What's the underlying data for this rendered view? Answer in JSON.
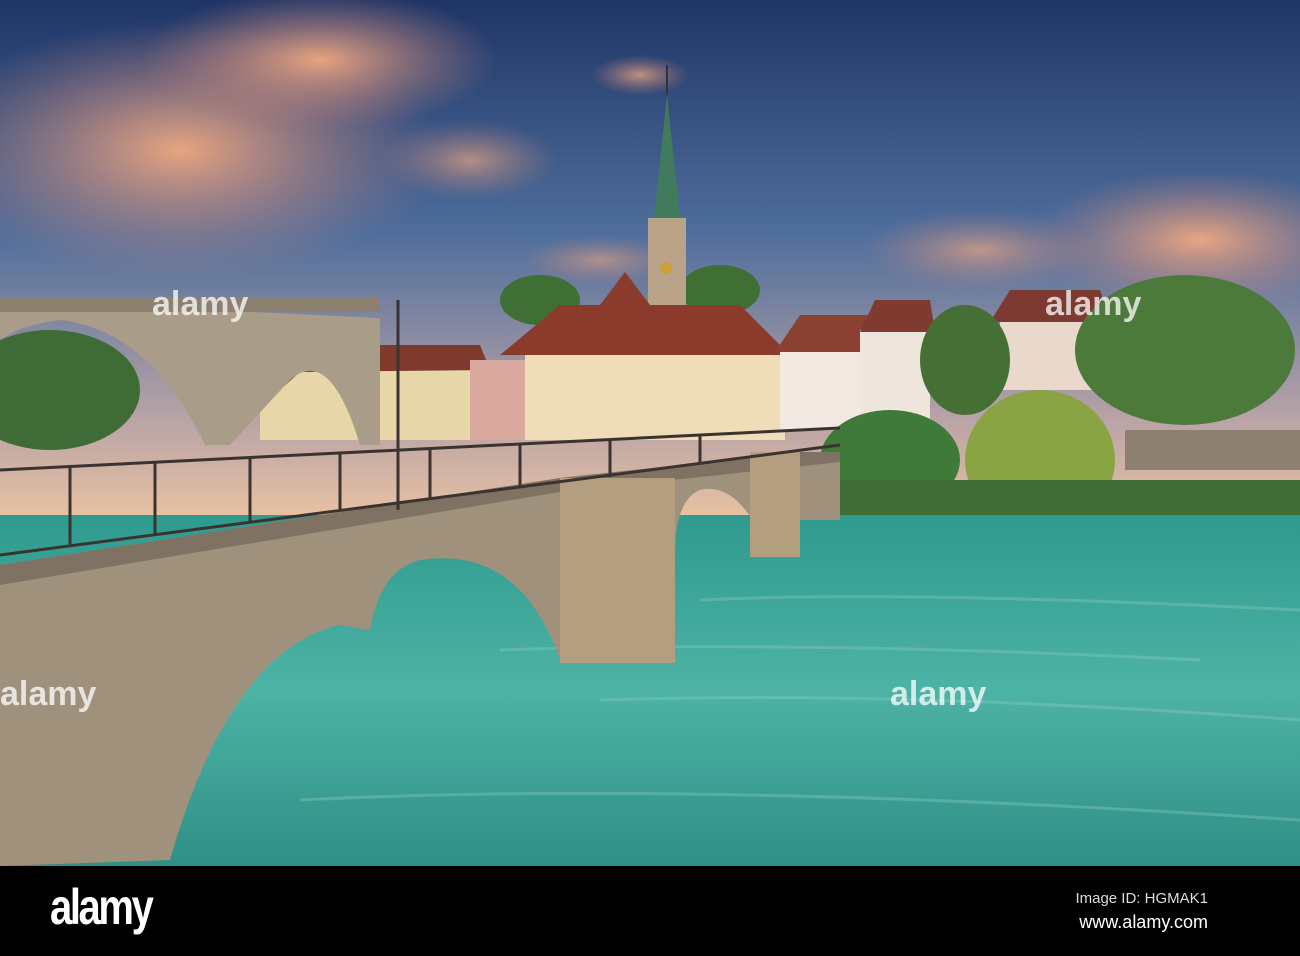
{
  "photo": {
    "watermark": "alamy",
    "colors": {
      "sky_top": "#1f3a6e",
      "cloud_pink": "#e8a07e",
      "river": "#3aa396",
      "stone": "#9c8d7a",
      "roof": "#8a3b2c"
    }
  },
  "footer": {
    "logo": "alamy",
    "image_id": "Image ID: HGMAK1",
    "url": "www.alamy.com"
  }
}
